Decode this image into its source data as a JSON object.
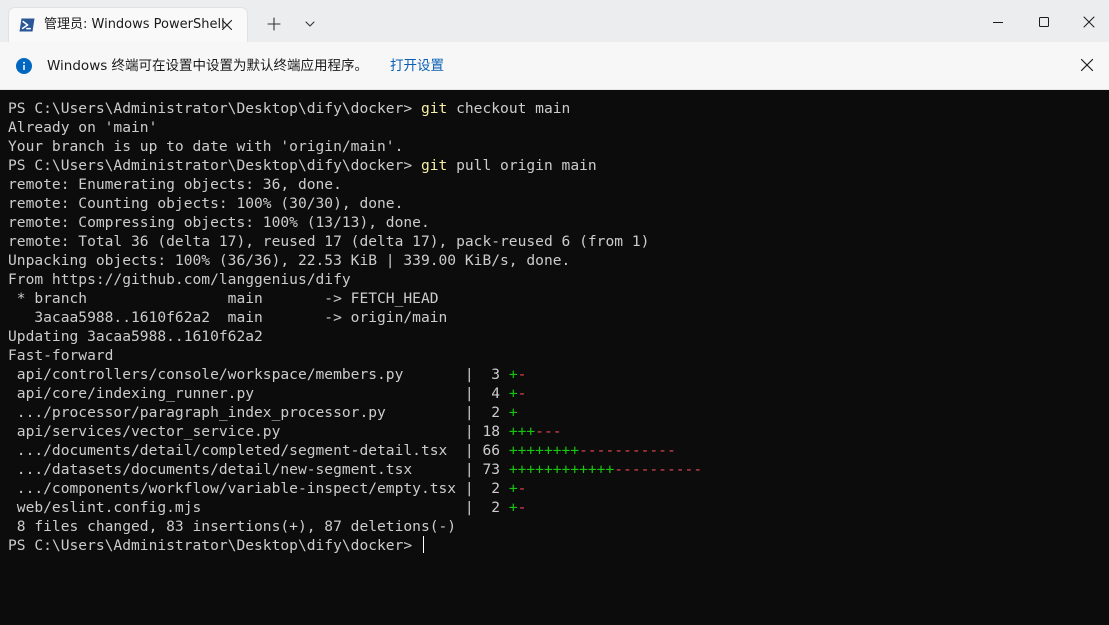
{
  "window": {
    "tab_title": "管理员: Windows PowerShell",
    "icons": {
      "tab": "powershell-icon",
      "tab_close": "close-icon",
      "new_tab": "plus-icon",
      "tab_menu": "chevron-down-icon",
      "minimize": "minimize-icon",
      "maximize": "maximize-icon",
      "close": "close-icon"
    }
  },
  "infobar": {
    "message": "Windows 终端可在设置中设置为默认终端应用程序。",
    "link": "打开设置",
    "icons": {
      "info": "info-icon",
      "close": "close-icon"
    }
  },
  "terminal": {
    "lines": [
      {
        "prefix": "PS C:\\Users\\Administrator\\Desktop\\dify\\docker> ",
        "cmd": "git",
        "rest": " checkout main"
      },
      {
        "text": "Already on 'main'"
      },
      {
        "text": "Your branch is up to date with 'origin/main'."
      },
      {
        "prefix": "PS C:\\Users\\Administrator\\Desktop\\dify\\docker> ",
        "cmd": "git",
        "rest": " pull origin main"
      },
      {
        "text": "remote: Enumerating objects: 36, done."
      },
      {
        "text": "remote: Counting objects: 100% (30/30), done."
      },
      {
        "text": "remote: Compressing objects: 100% (13/13), done."
      },
      {
        "text": "remote: Total 36 (delta 17), reused 17 (delta 17), pack-reused 6 (from 1)"
      },
      {
        "text": "Unpacking objects: 100% (36/36), 22.53 KiB | 339.00 KiB/s, done."
      },
      {
        "text": "From https://github.com/langgenius/dify"
      },
      {
        "text": " * branch                main       -> FETCH_HEAD"
      },
      {
        "text": "   3acaa5988..1610f62a2  main       -> origin/main"
      },
      {
        "text": "Updating 3acaa5988..1610f62a2"
      },
      {
        "text": "Fast-forward"
      },
      {
        "text": " api/controllers/console/workspace/members.py       |  3 ",
        "plus": "+",
        "minus": "-"
      },
      {
        "text": " api/core/indexing_runner.py                        |  4 ",
        "plus": "+",
        "minus": "-"
      },
      {
        "text": " .../processor/paragraph_index_processor.py         |  2 ",
        "plus": "+",
        "minus": ""
      },
      {
        "text": " api/services/vector_service.py                     | 18 ",
        "plus": "+++",
        "minus": "---"
      },
      {
        "text": " .../documents/detail/completed/segment-detail.tsx  | 66 ",
        "plus": "++++++++",
        "minus": "-----------"
      },
      {
        "text": " .../datasets/documents/detail/new-segment.tsx      | 73 ",
        "plus": "++++++++++++",
        "minus": "----------"
      },
      {
        "text": " .../components/workflow/variable-inspect/empty.tsx |  2 ",
        "plus": "+",
        "minus": "-"
      },
      {
        "text": " web/eslint.config.mjs                              |  2 ",
        "plus": "+",
        "minus": "-"
      },
      {
        "text": " 8 files changed, 83 insertions(+), 87 deletions(-)"
      },
      {
        "prefix": "PS C:\\Users\\Administrator\\Desktop\\dify\\docker> ",
        "cmd": "",
        "rest": "",
        "cursor": true
      }
    ]
  },
  "colors": {
    "terminal_bg": "#0c0c0c",
    "terminal_text": "#cccccc",
    "command": "#f9f1a5",
    "insertion": "#16c60c",
    "deletion": "#e74856",
    "link": "#0a5fb4",
    "info_icon": "#0067c0"
  }
}
